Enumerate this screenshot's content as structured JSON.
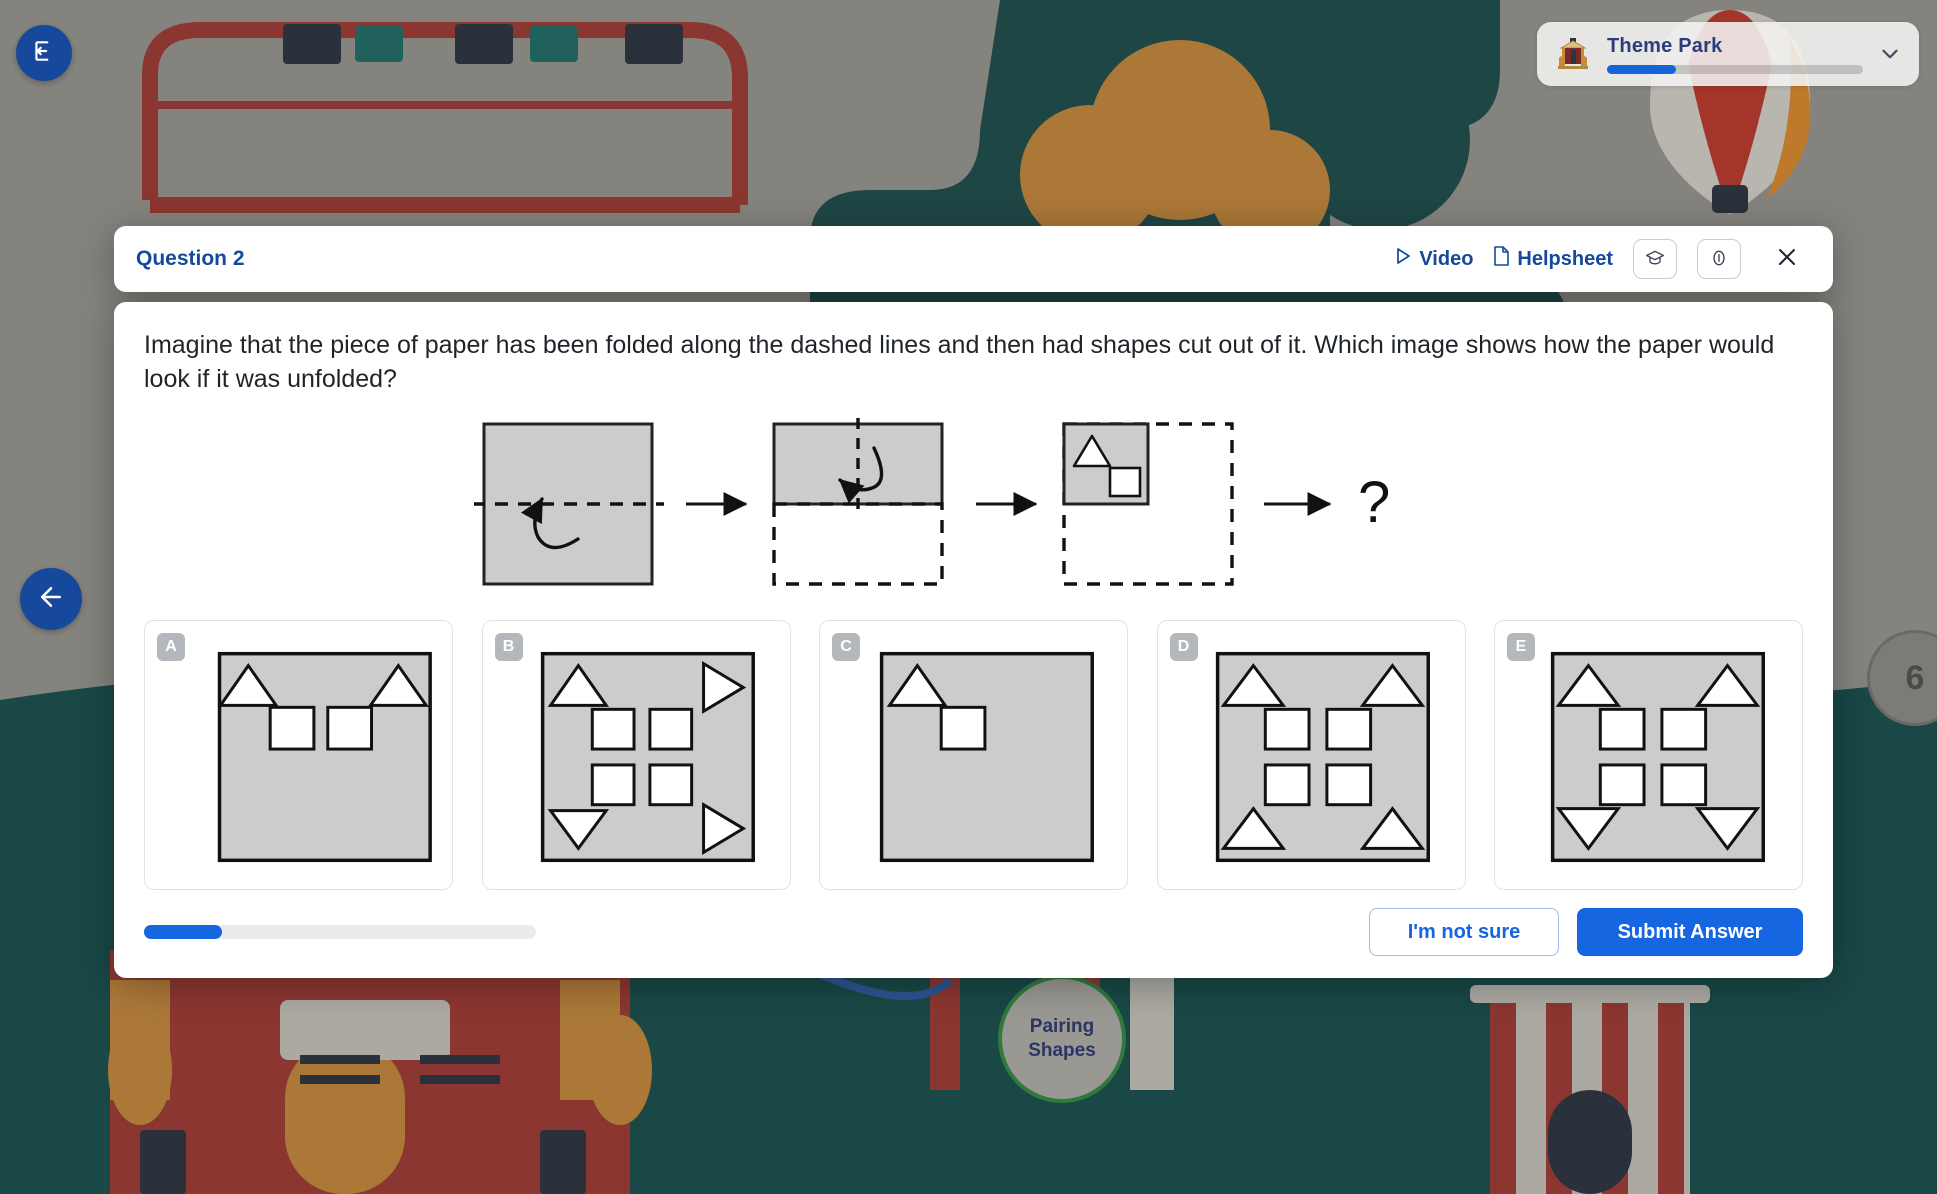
{
  "header": {
    "question_label": "Question 2",
    "video_label": "Video",
    "helpsheet_label": "Helpsheet",
    "video_icon": "play-triangle-icon",
    "helpsheet_icon": "document-icon",
    "graduation_icon": "graduation-cap-icon",
    "info_icon": "info-circle-icon",
    "close_icon": "close-x-icon"
  },
  "question": {
    "text": "Imagine that the piece of paper has been folded along the dashed lines and then had shapes cut out of it. Which image shows how the paper would look if it was unfolded?",
    "unknown_symbol": "?"
  },
  "diagram": {
    "steps": [
      {
        "name": "step-1-full-sheet",
        "fold": "horizontal",
        "fold_direction": "bottom-up",
        "shapes": []
      },
      {
        "name": "step-2-folded-in-half",
        "fold": "vertical",
        "fold_direction": "right-to-left",
        "shapes": []
      },
      {
        "name": "step-3-folded-quarter",
        "fold": "none",
        "shapes": [
          "triangle-up",
          "square"
        ]
      }
    ],
    "arrow_glyph": "→"
  },
  "options": [
    {
      "letter": "A",
      "shapes": "2 triangles pointing up at top corners, 2 squares below centre"
    },
    {
      "letter": "B",
      "shapes": "triangle up top-left, triangle right top-right, 4 squares, triangle down bottom-left, triangle right bottom-right"
    },
    {
      "letter": "C",
      "shapes": "1 triangle up top-left, 1 square"
    },
    {
      "letter": "D",
      "shapes": "4 triangles pointing up at corners, 4 squares in centre"
    },
    {
      "letter": "E",
      "shapes": "2 triangles pointing up at top corners, 2 triangles pointing down at bottom corners, 4 squares in centre"
    }
  ],
  "footer": {
    "progress_percent": 20,
    "not_sure_label": "I'm not sure",
    "submit_label": "Submit Answer"
  },
  "theme_park": {
    "title": "Theme Park",
    "progress_percent": 27,
    "icon": "carousel-icon",
    "chevron_icon": "chevron-down-icon"
  },
  "nav": {
    "exit_icon": "exit-door-icon",
    "back_icon": "arrow-left-icon"
  },
  "background": {
    "node_label": "Pairing\nShapes",
    "node_label_line1": "Pairing",
    "node_label_line2": "Shapes",
    "wheel_number": "6"
  },
  "colors": {
    "accent_blue": "#1566e0",
    "title_blue": "#16489c",
    "paper_grey": "#cccccc",
    "scene_teal": "#18514f",
    "scene_dark": "#1d2b3a"
  }
}
